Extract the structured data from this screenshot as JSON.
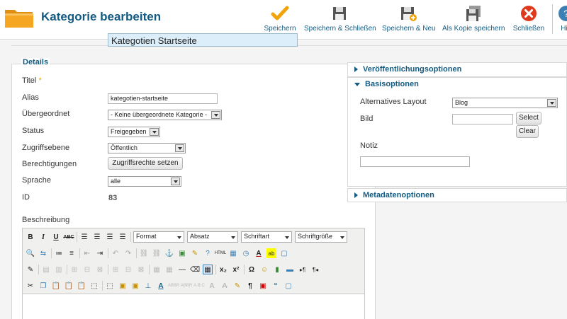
{
  "header": {
    "title": "Kategorie bearbeiten",
    "toolbar": {
      "save": "Speichern",
      "save_close": "Speichern & Schließen",
      "save_new": "Speichern & Neu",
      "save_copy": "Als Kopie speichern",
      "close": "Schließen",
      "help": "Hi"
    }
  },
  "details": {
    "legend": "Details",
    "title_label": "Titel",
    "required_star": "*",
    "title_value": "Kategotien Startseite",
    "alias_label": "Alias",
    "alias_value": "kategotien-startseite",
    "parent_label": "Übergeordnet",
    "parent_value": "- Keine übergeordnete Kategorie -",
    "status_label": "Status",
    "status_value": "Freigegeben",
    "access_label": "Zugriffsebene",
    "access_value": "Öffentlich",
    "permissions_label": "Berechtigungen",
    "permissions_button": "Zugriffsrechte setzen",
    "language_label": "Sprache",
    "language_value": "alle",
    "id_label": "ID",
    "id_value": "83",
    "description_label": "Beschreibung"
  },
  "editor": {
    "format": "Format",
    "paragraph": "Absatz",
    "font": "Schriftart",
    "size": "Schriftgröße"
  },
  "side": {
    "publishing": "Veröffentlichungsoptionen",
    "basic": "Basisoptionen",
    "layout_label": "Alternatives Layout",
    "layout_value": "Blog",
    "image_label": "Bild",
    "select_button": "Select",
    "clear_button": "Clear",
    "note_label": "Notiz",
    "metadata": "Metadatenoptionen"
  },
  "colors": {
    "accent": "#135b82",
    "title_bg": "#dceef9",
    "save_check": "#f0a30a",
    "close_red": "#e03a1e"
  }
}
